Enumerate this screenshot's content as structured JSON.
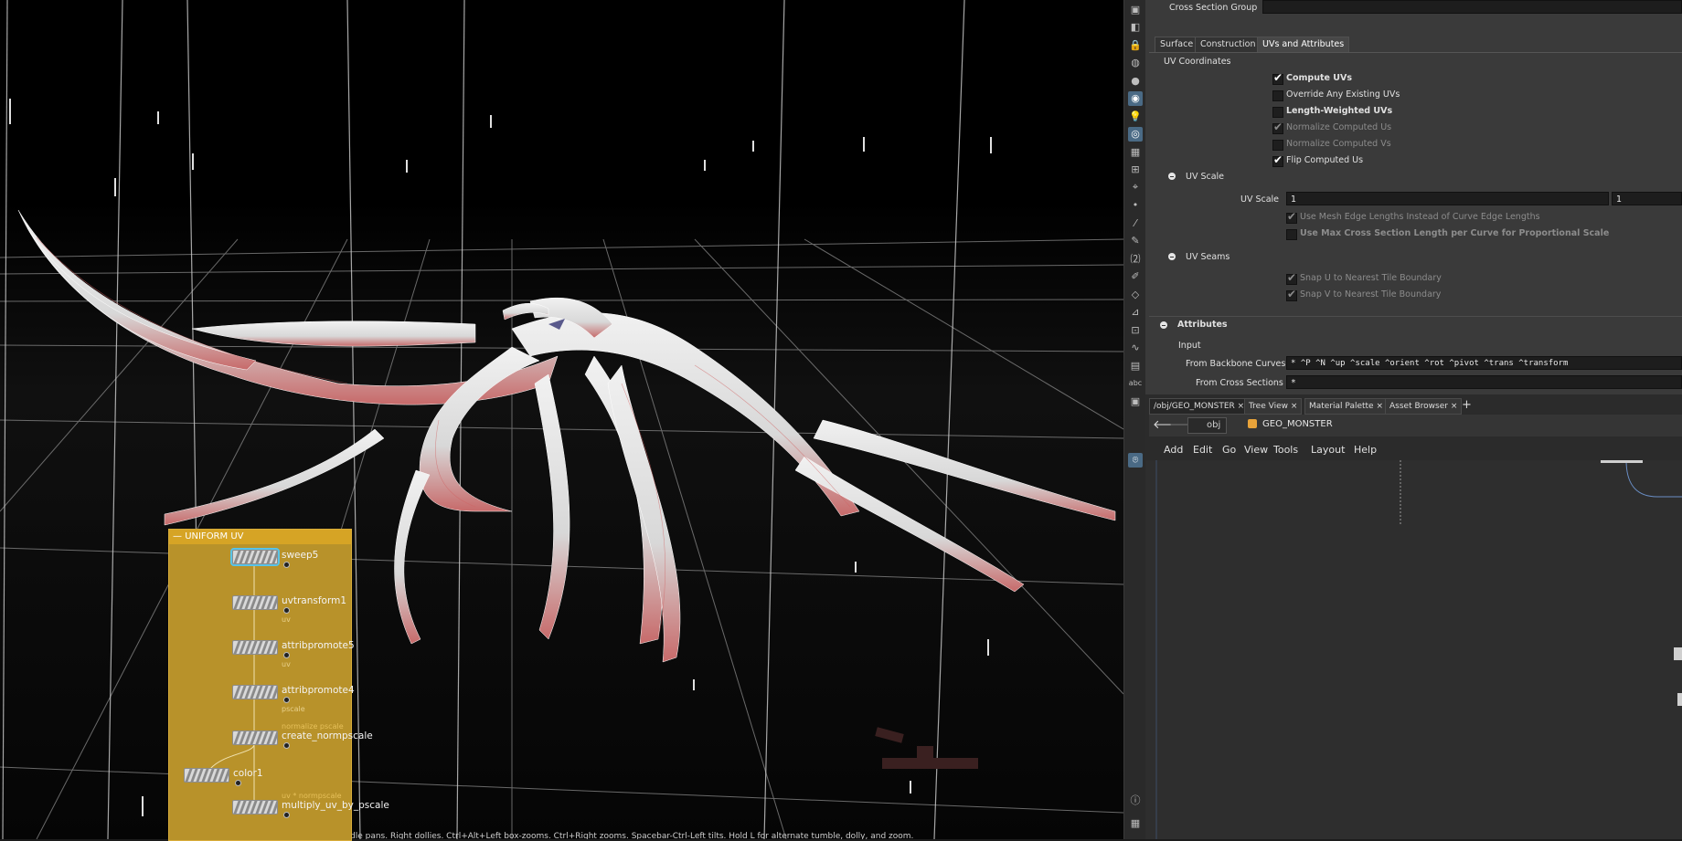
{
  "viewport": {
    "status_text": "Left mouse tumbles. Middle pans. Right dollies. Ctrl+Alt+Left box-zooms. Ctrl+Right zooms. Spacebar-Ctrl-Left tilts. Hold L for alternate tumble, dolly, and zoom."
  },
  "toolbar": {
    "icons": [
      "cube-icon",
      "layers-icon",
      "lock-icon",
      "globe-icon",
      "sphere-icon",
      "light-icon",
      "bulb-icon",
      "camera-icon",
      "view-icon",
      "grid-icon",
      "snap-icon",
      "dot-icon",
      "brush-icon",
      "pencil-icon",
      "number-icon",
      "paint-icon",
      "shape-icon",
      "measure-icon",
      "crop-icon",
      "magnet-icon",
      "material-icon",
      "text-icon",
      "display-icon",
      "pin-icon",
      "info-icon",
      "tiles-icon"
    ],
    "abc_label": "abc"
  },
  "params": {
    "top_field_label": "Cross Section Group",
    "tabs": [
      "Surface",
      "Construction",
      "UVs and Attributes"
    ],
    "uv_coordinates": {
      "heading": "UV Coordinates",
      "options": [
        {
          "label": "Compute UVs",
          "checked": true,
          "bold": true,
          "dim": false
        },
        {
          "label": "Override Any Existing UVs",
          "checked": false,
          "bold": false,
          "dim": false
        },
        {
          "label": "Length-Weighted UVs",
          "checked": false,
          "bold": true,
          "dim": false
        },
        {
          "label": "Normalize Computed Us",
          "checked": true,
          "bold": false,
          "dim": true
        },
        {
          "label": "Normalize Computed Vs",
          "checked": false,
          "bold": false,
          "dim": true
        },
        {
          "label": "Flip Computed Us",
          "checked": true,
          "bold": false,
          "dim": false
        }
      ]
    },
    "uv_scale": {
      "heading": "UV Scale",
      "field_label": "UV Scale",
      "value_u": "1",
      "value_v": "1",
      "options": [
        {
          "label": "Use Mesh Edge Lengths Instead of Curve Edge Lengths",
          "checked": true,
          "bold": false
        },
        {
          "label": "Use Max Cross Section Length per Curve for Proportional Scale",
          "checked": false,
          "bold": true
        }
      ]
    },
    "uv_seams": {
      "heading": "UV Seams",
      "options": [
        {
          "label": "Snap U to Nearest Tile Boundary",
          "checked": true
        },
        {
          "label": "Snap V to Nearest Tile Boundary",
          "checked": true
        }
      ]
    },
    "attributes": {
      "heading": "Attributes",
      "sub": "Input",
      "backbone_label": "From Backbone Curves",
      "backbone_value": "* ^P ^N ^up ^scale ^orient ^rot ^pivot ^trans ^transform",
      "cross_label": "From Cross Sections",
      "cross_value": "*"
    }
  },
  "network": {
    "tabs": [
      "/obj/GEO_MONSTER",
      "Tree View",
      "Material Palette",
      "Asset Browser"
    ],
    "path_root": "obj",
    "path_node": "GEO_MONSTER",
    "menu": [
      "Add",
      "Edit",
      "Go",
      "View",
      "Tools",
      "Layout",
      "Help"
    ],
    "netbox_title": "UNIFORM UV",
    "nodes": [
      {
        "name": "sweep5",
        "sub": "",
        "comment": ""
      },
      {
        "name": "uvtransform1",
        "sub": "uv",
        "comment": ""
      },
      {
        "name": "attribpromote5",
        "sub": "uv",
        "comment": ""
      },
      {
        "name": "attribpromote4",
        "sub": "pscale",
        "comment": ""
      },
      {
        "name": "create_normpscale",
        "sub": "",
        "comment": "normalize pscale"
      },
      {
        "name": "color1",
        "sub": "",
        "comment": ""
      },
      {
        "name": "multiply_uv_by_pscale",
        "sub": "",
        "comment": "uv * normpscale"
      }
    ]
  }
}
